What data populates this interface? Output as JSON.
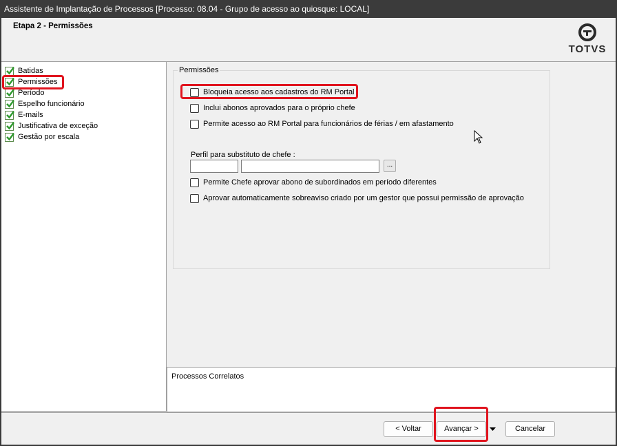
{
  "window": {
    "title": "Assistente de Implantação de Processos [Processo: 08.04 - Grupo de acesso ao quiosque: LOCAL]"
  },
  "header": {
    "step_title": "Etapa 2 - Permissões",
    "logo_text": "TOTVS",
    "logo_icon": "totvs-logo-icon"
  },
  "tree": {
    "items": [
      {
        "label": "Batidas",
        "icon": "check-icon"
      },
      {
        "label": "Permissões",
        "icon": "check-icon"
      },
      {
        "label": "Período",
        "icon": "check-icon"
      },
      {
        "label": "Espelho funcionário",
        "icon": "check-icon"
      },
      {
        "label": "E-mails",
        "icon": "check-icon"
      },
      {
        "label": "Justificativa de exceção",
        "icon": "check-icon"
      },
      {
        "label": "Gestão por escala",
        "icon": "check-icon"
      }
    ]
  },
  "permissions": {
    "legend": "Permissões",
    "options": [
      {
        "label": "Bloqueia acesso aos cadastros do RM Portal",
        "checked": false
      },
      {
        "label": "Inclui abonos aprovados para o próprio chefe",
        "checked": false
      },
      {
        "label": "Permite acesso ao RM Portal para funcionários de férias / em afastamento",
        "checked": false
      },
      {
        "label": "Permite Chefe aprovar abono de subordinados em período diferentes",
        "checked": false
      },
      {
        "label": "Aprovar automaticamente sobreaviso criado por um gestor que possui permissão de aprovação",
        "checked": false
      }
    ],
    "substitute_label": "Perfil para substituto de chefe :",
    "substitute_code": "",
    "substitute_name": "",
    "lookup_label": "..."
  },
  "related": {
    "label": "Processos Correlatos"
  },
  "footer": {
    "back_label": "< Voltar",
    "next_label": "Avançar >",
    "cancel_label": "Cancelar"
  },
  "colors": {
    "highlight": "#e0141e",
    "check_green": "#2e9a2e"
  }
}
